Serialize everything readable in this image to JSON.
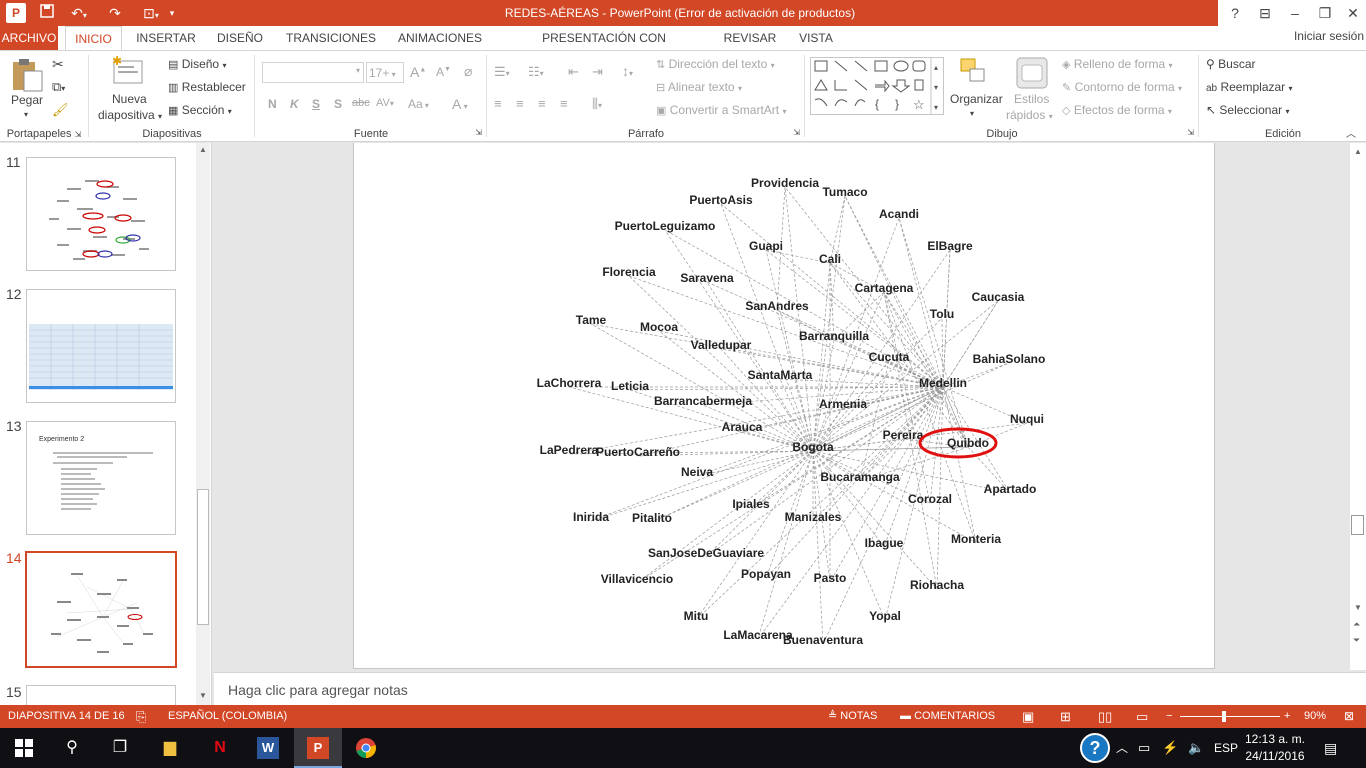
{
  "app": {
    "title": "REDES-AÉREAS -  PowerPoint (Error de activación de productos)",
    "logo": "P"
  },
  "colors": {
    "accent": "#d24726",
    "taskbar": "#101014"
  },
  "tabs": {
    "file": "ARCHIVO",
    "items": [
      "INICIO",
      "INSERTAR",
      "DISEÑO",
      "TRANSICIONES",
      "ANIMACIONES",
      "PRESENTACIÓN CON DIAPOSITIVAS",
      "REVISAR",
      "VISTA"
    ],
    "active": "INICIO",
    "signin": "Iniciar sesión"
  },
  "ribbon": {
    "clipboard": {
      "label": "Portapapeles",
      "paste": "Pegar"
    },
    "slides": {
      "label": "Diapositivas",
      "new_slide_1": "Nueva",
      "new_slide_2": "diapositiva",
      "layout": "Diseño",
      "reset": "Restablecer",
      "section": "Sección"
    },
    "font": {
      "label": "Fuente",
      "size": "17+",
      "bold": "N",
      "italic": "K",
      "underline": "S",
      "shadow": "S",
      "strike": "abc",
      "spacing": "AV",
      "case": "Aa",
      "color": "A",
      "grow": "A",
      "shrink": "A"
    },
    "paragraph": {
      "label": "Párrafo",
      "text_direction": "Dirección del texto",
      "align_text": "Alinear texto",
      "smartart": "Convertir a SmartArt"
    },
    "drawing": {
      "label": "Dibujo",
      "arrange": "Organizar",
      "styles_1": "Estilos",
      "styles_2": "rápidos",
      "fill": "Relleno de forma",
      "outline": "Contorno de forma",
      "effects": "Efectos de forma"
    },
    "editing": {
      "label": "Edición",
      "find": "Buscar",
      "replace": "Reemplazar",
      "select": "Seleccionar"
    }
  },
  "thumbnails": {
    "numbers": [
      "11",
      "12",
      "13",
      "14",
      "15"
    ],
    "slide13_title": "Experimento 2"
  },
  "chart_data": {
    "type": "network",
    "nodes": [
      "Providencia",
      "Tumaco",
      "PuertoAsis",
      "Acandi",
      "PuertoLeguizamo",
      "Guapi",
      "ElBagre",
      "Cali",
      "Florencia",
      "Saravena",
      "Cartagena",
      "Caucasia",
      "SanAndres",
      "Tolu",
      "Tame",
      "Mocoa",
      "Barranquilla",
      "Valledupar",
      "Cucuta",
      "BahiaSolano",
      "SantaMarta",
      "Medellin",
      "LaChorrera",
      "Leticia",
      "Barrancabermeja",
      "Armenia",
      "Nuqui",
      "Arauca",
      "Pereira",
      "Quibdo",
      "LaPedrera",
      "PuertoCarreño",
      "Bogota",
      "Neiva",
      "Bucaramanga",
      "Apartado",
      "Corozal",
      "Ipiales",
      "Inirida",
      "Pitalito",
      "Manizales",
      "Monteria",
      "Ibague",
      "SanJoseDeGuaviare",
      "Popayan",
      "Pasto",
      "Villavicencio",
      "Riohacha",
      "Mitu",
      "Yopal",
      "LaMacarena",
      "Buenaventura"
    ],
    "hubs": [
      "Bogota",
      "Medellin"
    ],
    "highlighted": "Quibdo"
  },
  "notes": {
    "placeholder": "Haga clic para agregar notas"
  },
  "status": {
    "slide": "DIAPOSITIVA 14 DE 16",
    "language": "ESPAÑOL (COLOMBIA)",
    "notes": "NOTAS",
    "comments": "COMENTARIOS",
    "zoom": "90%"
  },
  "taskbar": {
    "lang": "ESP",
    "time": "12:13 a. m.",
    "date": "24/11/2016"
  }
}
